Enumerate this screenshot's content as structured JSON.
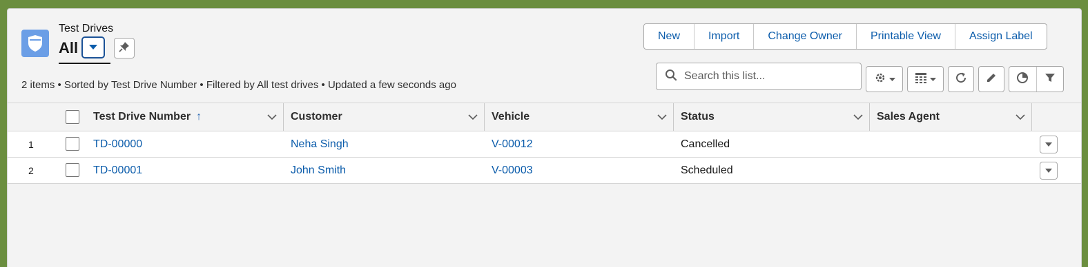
{
  "header": {
    "object_title": "Test Drives",
    "view_name": "All"
  },
  "toolbar": {
    "buttons": [
      "New",
      "Import",
      "Change Owner",
      "Printable View",
      "Assign Label"
    ]
  },
  "meta": {
    "summary": "2 items • Sorted by Test Drive Number • Filtered by All test drives • Updated a few seconds ago"
  },
  "search": {
    "placeholder": "Search this list..."
  },
  "icons": {
    "object": "test-drive-badge-icon",
    "view_switch": "caret-down-icon",
    "pin": "pin-icon",
    "search": "search-icon",
    "settings": "gear-icon",
    "display_as": "table-icon",
    "refresh": "refresh-icon",
    "edit": "pencil-icon",
    "charts": "pie-chart-icon",
    "filter": "filter-icon"
  },
  "table": {
    "columns": [
      "Test Drive Number",
      "Customer",
      "Vehicle",
      "Status",
      "Sales Agent"
    ],
    "sort_indicator": "↑",
    "rows": [
      {
        "num": "1",
        "test_drive_number": "TD-00000",
        "customer": "Neha Singh",
        "vehicle": "V-00012",
        "status": "Cancelled",
        "sales_agent": ""
      },
      {
        "num": "2",
        "test_drive_number": "TD-00001",
        "customer": "John Smith",
        "vehicle": "V-00003",
        "status": "Scheduled",
        "sales_agent": ""
      }
    ]
  },
  "colors": {
    "brand_link": "#0b5cab",
    "object_icon": "#6b9ee6",
    "page_border": "#6b8e3f"
  }
}
